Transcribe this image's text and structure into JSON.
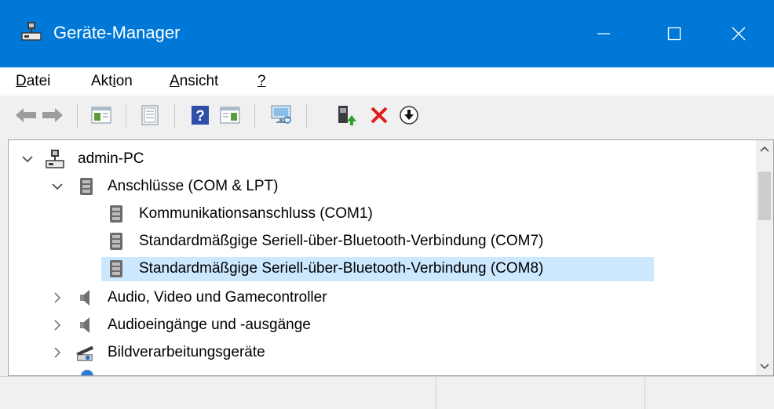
{
  "window": {
    "title": "Geräte-Manager",
    "accent": "#0078d7"
  },
  "menu": [
    {
      "pre": "",
      "key": "D",
      "post": "atei"
    },
    {
      "pre": "Akt",
      "key": "i",
      "post": "on"
    },
    {
      "pre": "",
      "key": "A",
      "post": "nsicht"
    },
    {
      "pre": "",
      "key": "?",
      "post": ""
    }
  ],
  "tree": {
    "root": "admin-PC",
    "category": "Anschlüsse (COM & LPT)",
    "ports": [
      "Kommunikationsanschluss (COM1)",
      "Standardmäßgige Seriell-über-Bluetooth-Verbindung (COM7)",
      "Standardmäßgige Seriell-über-Bluetooth-Verbindung (COM8)"
    ],
    "categories": [
      "Audio, Video und Gamecontroller",
      "Audioeingänge und -ausgänge",
      "Bildverarbeitungsgeräte"
    ],
    "selected_color": "#cce8ff"
  },
  "icons": {
    "toolbar": [
      "back-arrow-icon",
      "forward-arrow-icon",
      "show-hide-tree-icon",
      "properties-icon",
      "help-icon",
      "action-pane-icon",
      "scan-hardware-icon",
      "update-driver-icon",
      "uninstall-icon",
      "disable-device-icon"
    ]
  }
}
